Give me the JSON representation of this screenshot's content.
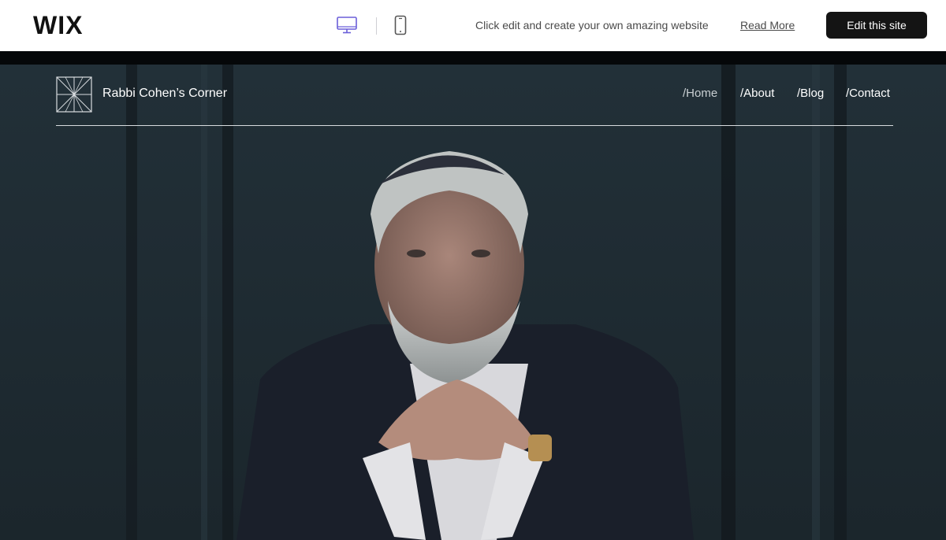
{
  "wix_bar": {
    "logo": "WIX",
    "promo_text": "Click edit and create your own amazing website",
    "read_more": "Read More",
    "edit_button": "Edit this site",
    "desktop_icon": "desktop-icon",
    "mobile_icon": "mobile-icon"
  },
  "site": {
    "title": "Rabbi Cohen’s Corner",
    "logo_icon": "geometric-square-logo",
    "nav": [
      {
        "label": "/Home"
      },
      {
        "label": "/About"
      },
      {
        "label": "/Blog"
      },
      {
        "label": "/Contact"
      }
    ],
    "hero_image": "portrait-of-rabbi",
    "colors": {
      "background": "#1f2a30",
      "header_text": "#ffffff",
      "accent_desktop": "#6b5fd9"
    }
  }
}
